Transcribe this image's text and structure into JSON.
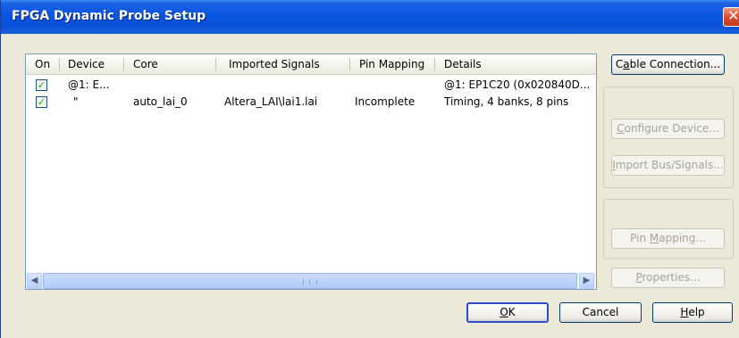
{
  "window": {
    "title": "FPGA Dynamic Probe Setup",
    "close_glyph": "✕"
  },
  "table": {
    "columns": [
      "On",
      "Device",
      "Core",
      "Imported Signals",
      "Pin Mapping",
      "Details"
    ],
    "rows": [
      {
        "on": true,
        "device": "@1: E...",
        "core": "",
        "imported_signals": "",
        "pin_mapping": "",
        "details": "@1: EP1C20 (0x020840D..."
      },
      {
        "on": true,
        "device": "\"",
        "core": "auto_lai_0",
        "imported_signals": "Altera_LAI\\lai1.lai",
        "pin_mapping": "Incomplete",
        "details": "Timing, 4 banks, 8 pins"
      }
    ],
    "scrollbar": {
      "left_arrow": "◀",
      "right_arrow": "▶"
    }
  },
  "buttons": {
    "cable_connection": {
      "prefix": "C",
      "mnemonic": "a",
      "rest": "ble Connection..."
    },
    "configure_device": {
      "prefix": "",
      "mnemonic": "C",
      "rest": "onfigure Device..."
    },
    "import_bus": {
      "prefix": "",
      "mnemonic": "I",
      "rest": "mport Bus/Signals..."
    },
    "pin_mapping": {
      "prefix": "Pin ",
      "mnemonic": "M",
      "rest": "apping..."
    },
    "properties": {
      "prefix": "",
      "mnemonic": "P",
      "rest": "roperties..."
    },
    "ok": {
      "prefix": "",
      "mnemonic": "O",
      "rest": "K"
    },
    "cancel": {
      "label": "Cancel"
    },
    "help": {
      "prefix": "",
      "mnemonic": "H",
      "rest": "elp"
    }
  },
  "colors": {
    "title_bar": "#0a54e0",
    "checkbox_check": "#21a121",
    "dialog_bg": "#ece9d8"
  }
}
